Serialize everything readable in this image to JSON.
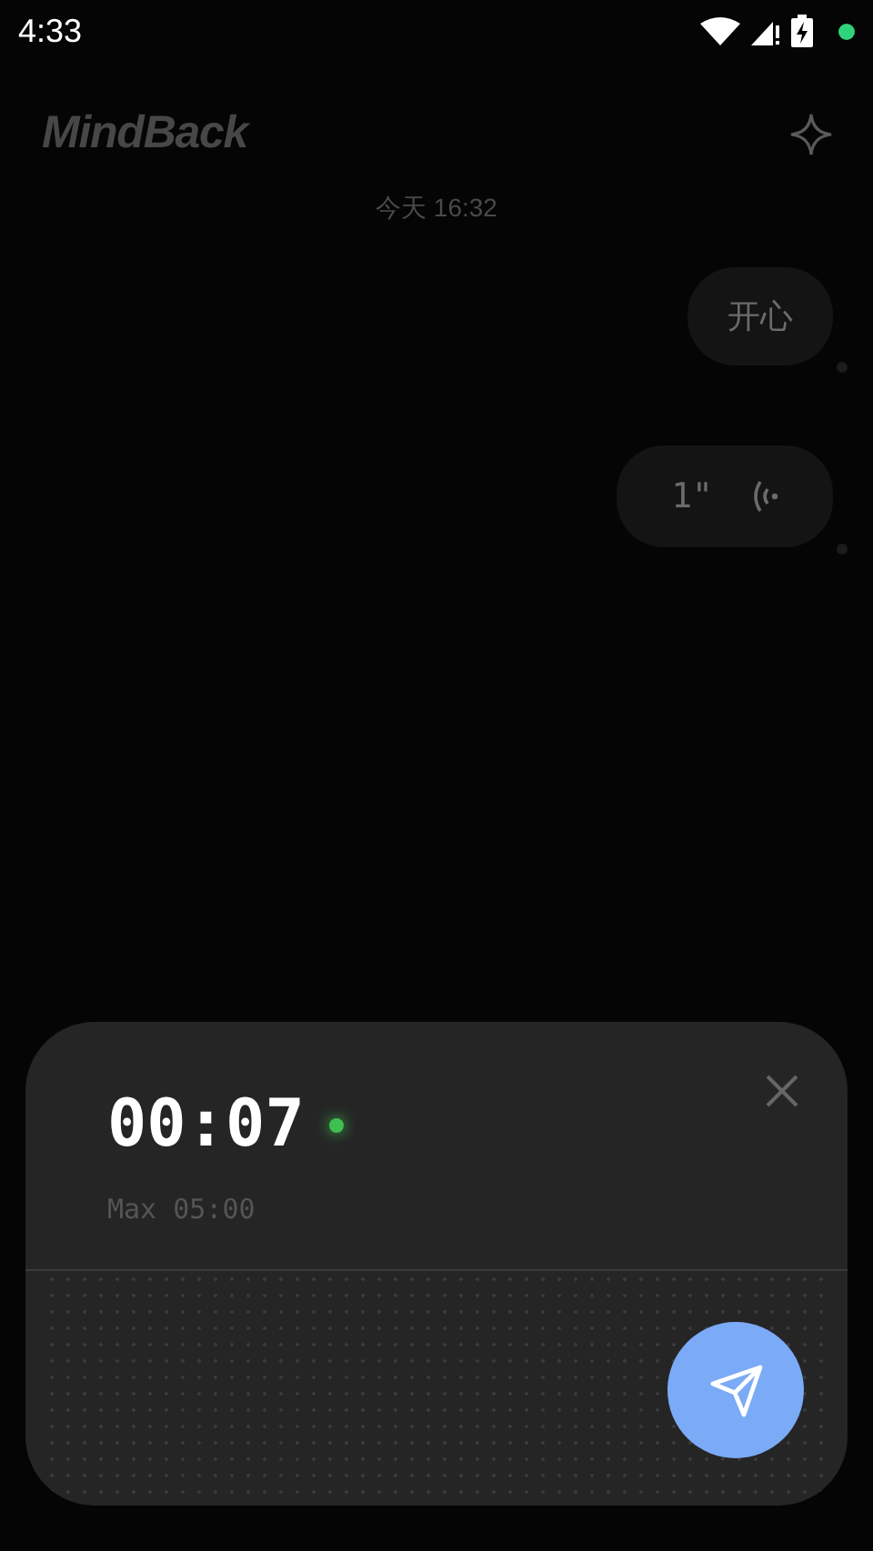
{
  "status_bar": {
    "time": "4:33"
  },
  "header": {
    "logo": "MindBack"
  },
  "date_label": "今天 16:32",
  "messages": [
    {
      "kind": "text",
      "text": "开心"
    },
    {
      "kind": "voice",
      "text": "1\""
    }
  ],
  "recorder": {
    "elapsed": "00:07",
    "recording": true,
    "limit": "Max 05:00"
  }
}
